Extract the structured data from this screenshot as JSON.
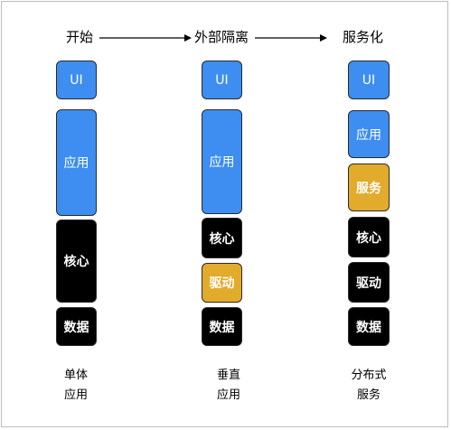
{
  "stages": [
    "开始",
    "外部隔离",
    "服务化"
  ],
  "columns": [
    {
      "id": "monolith",
      "blocks": [
        {
          "label": "UI",
          "color": "blue"
        },
        {
          "label": "应用",
          "color": "blue"
        },
        {
          "label": "核心",
          "color": "black"
        },
        {
          "label": "数据",
          "color": "black"
        }
      ],
      "caption": [
        "单体",
        "应用"
      ]
    },
    {
      "id": "vertical",
      "blocks": [
        {
          "label": "UI",
          "color": "blue"
        },
        {
          "label": "应用",
          "color": "blue"
        },
        {
          "label": "核心",
          "color": "black"
        },
        {
          "label": "驱动",
          "color": "gold"
        },
        {
          "label": "数据",
          "color": "black"
        }
      ],
      "caption": [
        "垂直",
        "应用"
      ]
    },
    {
      "id": "distributed",
      "blocks": [
        {
          "label": "UI",
          "color": "blue"
        },
        {
          "label": "应用",
          "color": "blue"
        },
        {
          "label": "服务",
          "color": "gold"
        },
        {
          "label": "核心",
          "color": "black"
        },
        {
          "label": "驱动",
          "color": "black"
        },
        {
          "label": "数据",
          "color": "black"
        }
      ],
      "caption": [
        "分布式",
        "服务"
      ]
    }
  ],
  "colors": {
    "blue": "#3d8ef0",
    "black": "#000000",
    "gold": "#e2ab2c",
    "border": "#2a2a2a"
  }
}
